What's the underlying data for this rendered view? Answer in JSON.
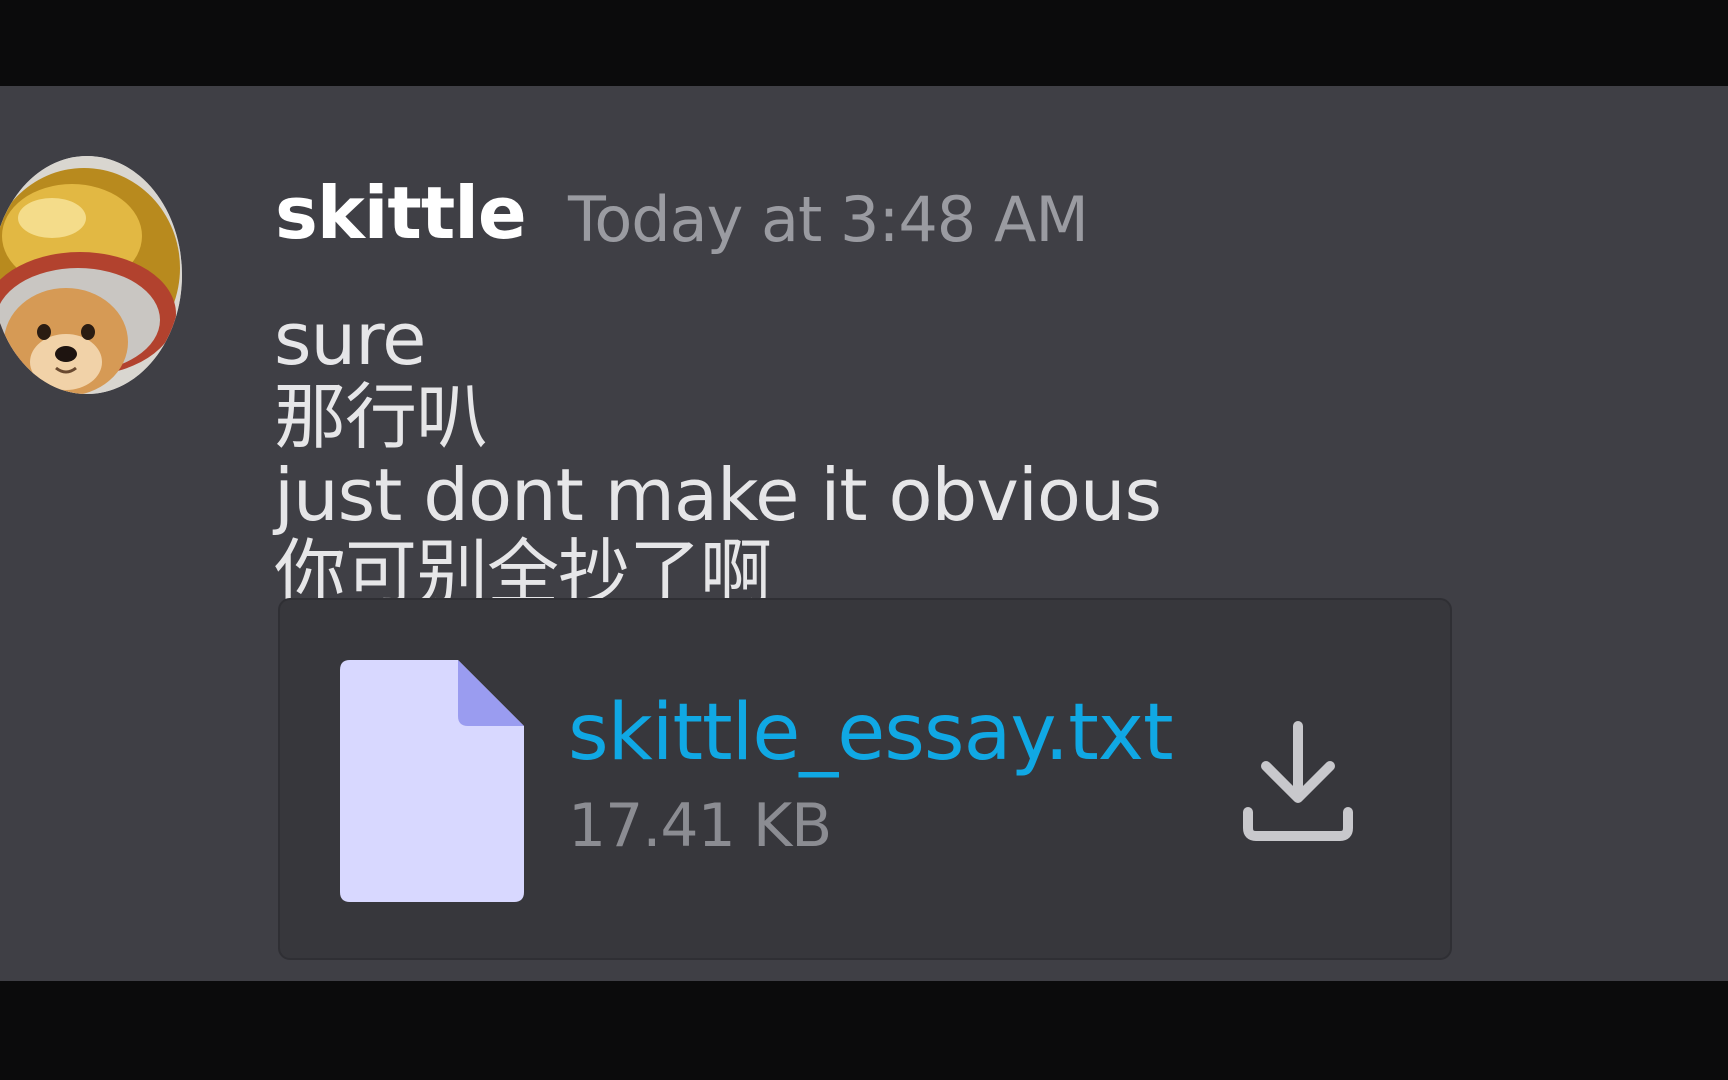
{
  "message": {
    "author": "skittle",
    "timestamp": "Today at 3:48 AM",
    "lines": [
      "sure",
      "那行叭",
      "just dont make it obvious",
      "你可别全抄了啊"
    ]
  },
  "attachment": {
    "file_name": "skittle_essay.txt",
    "file_size": "17.41 KB",
    "icon": "file-icon"
  },
  "icons": {
    "avatar": "dog-in-helmet-avatar",
    "download": "download-icon"
  },
  "colors": {
    "background": "#3f3f45",
    "letterbox": "#0b0b0c",
    "attachment_bg": "#37373c",
    "link": "#10a8e4",
    "timestamp": "#9a9ba1",
    "file_icon": "#d8d8ff",
    "file_icon_fold": "#9a9cf0"
  }
}
